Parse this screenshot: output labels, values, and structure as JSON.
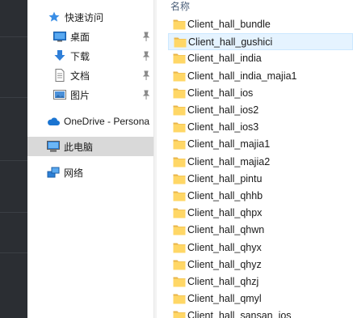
{
  "nav_pane": {
    "quick_access": "快速访问",
    "pinned": [
      {
        "label": "桌面",
        "icon": "desktop-folder-icon"
      },
      {
        "label": "下载",
        "icon": "download-arrow-icon"
      },
      {
        "label": "文档",
        "icon": "document-icon"
      },
      {
        "label": "图片",
        "icon": "picture-icon"
      }
    ],
    "onedrive": "OneDrive - Persona",
    "this_pc": "此电脑",
    "network": "网络"
  },
  "file_list": {
    "column_name": "名称",
    "items": [
      "Client_hall_bundle",
      "Client_hall_gushici",
      "Client_hall_india",
      "Client_hall_india_majia1",
      "Client_hall_ios",
      "Client_hall_ios2",
      "Client_hall_ios3",
      "Client_hall_majia1",
      "Client_hall_majia2",
      "Client_hall_pintu",
      "Client_hall_qhhb",
      "Client_hall_qhpx",
      "Client_hall_qhwn",
      "Client_hall_qhyx",
      "Client_hall_qhyz",
      "Client_hall_qhzj",
      "Client_hall_qmyl",
      "Client_hall_sansan_ios"
    ],
    "hovered_index": 1
  },
  "colors": {
    "folder": "#ffd766",
    "accent": "#0078d7",
    "hover_bg": "#e5f3ff",
    "selected_bg": "#d9d9d9"
  }
}
